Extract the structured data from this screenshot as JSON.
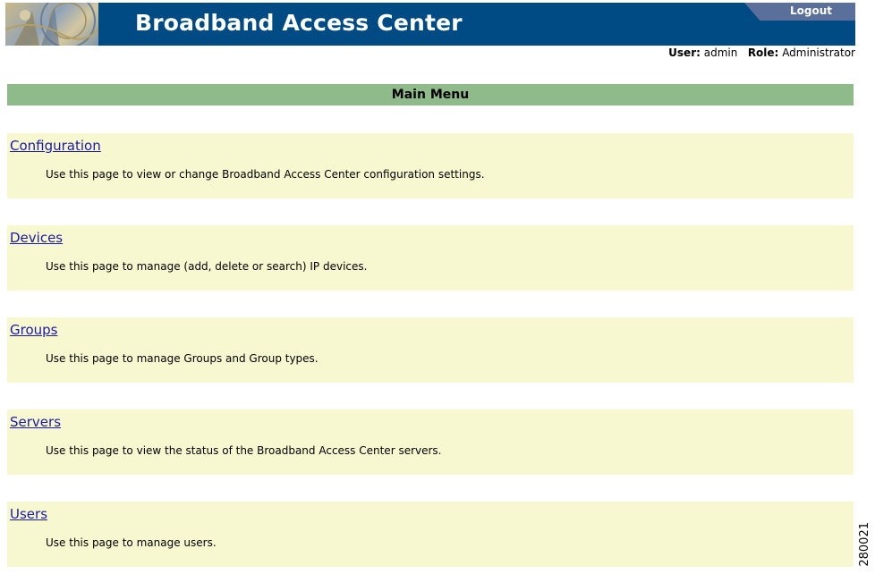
{
  "header": {
    "title": "Broadband Access Center",
    "logout_label": "Logout",
    "user_label": "User:",
    "user_value": "admin",
    "role_label": "Role:",
    "role_value": "Administrator",
    "logo_icon": "broadband-photo-logo"
  },
  "menu": {
    "title": "Main Menu",
    "items": [
      {
        "label": "Configuration",
        "description": "Use this page to view or change Broadband Access Center configuration settings."
      },
      {
        "label": "Devices",
        "description": "Use this page to manage (add, delete or search) IP devices."
      },
      {
        "label": "Groups",
        "description": "Use this page to manage Groups and Group types."
      },
      {
        "label": "Servers",
        "description": "Use this page to view the status of the Broadband Access Center servers."
      },
      {
        "label": "Users",
        "description": "Use this page to manage users."
      }
    ]
  },
  "figure_id": "280021",
  "colors": {
    "banner": "#004b84",
    "menu_header": "#8fbb8b",
    "section_bg": "#f8f8d0",
    "link": "#1a1aa6"
  }
}
